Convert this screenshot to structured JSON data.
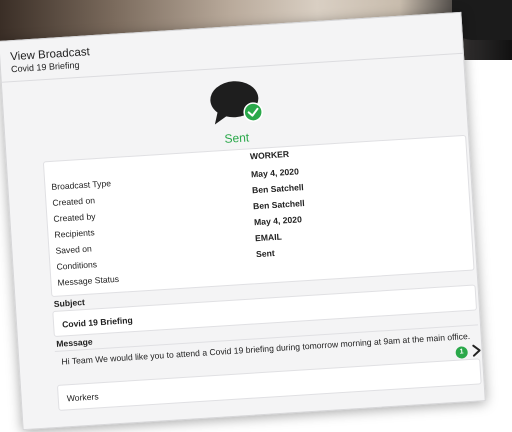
{
  "header": {
    "title": "View Broadcast",
    "subtitle": "Covid 19 Briefing"
  },
  "status": {
    "label": "Sent",
    "color": "#2aa84a",
    "icon": "chat-bubble-check-icon"
  },
  "details": {
    "rows": [
      {
        "key": "",
        "value": "WORKER"
      },
      {
        "key": "Broadcast Type",
        "value": "May 4, 2020"
      },
      {
        "key": "Created on",
        "value": "Ben Satchell"
      },
      {
        "key": "Created by",
        "value": "Ben Satchell"
      },
      {
        "key": "Recipients",
        "value": "May 4, 2020"
      },
      {
        "key": "Saved on",
        "value": "EMAIL"
      },
      {
        "key": "Conditions",
        "value": "Sent"
      },
      {
        "key": "Message Status",
        "value": ""
      }
    ]
  },
  "subject": {
    "label": "Subject",
    "value": "Covid 19 Briefing"
  },
  "message": {
    "label": "Message",
    "value": "Hi Team We would like you to attend a Covid 19 briefing during tomorrow morning at 9am at the main office."
  },
  "recipients": {
    "count": "1",
    "group": "Workers"
  }
}
